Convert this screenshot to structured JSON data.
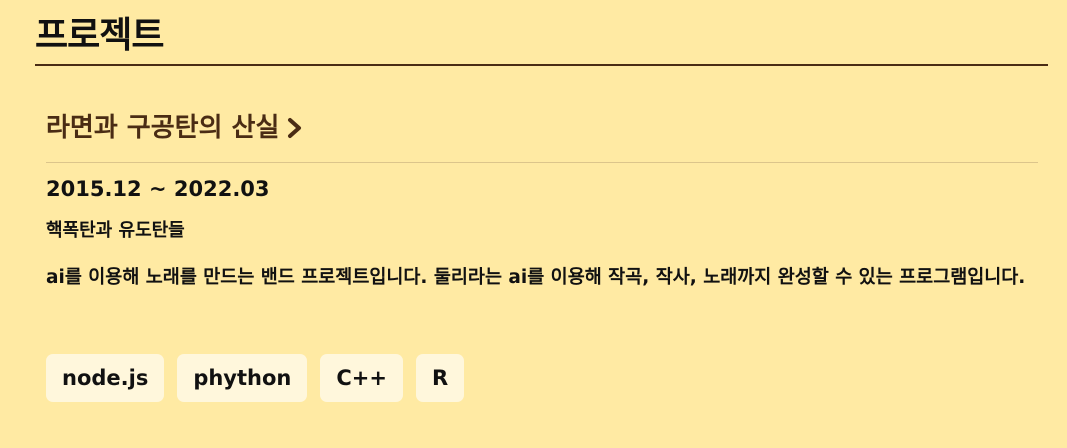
{
  "section": {
    "title": "프로젝트"
  },
  "project": {
    "title": "라면과 구공탄의 산실",
    "chevron_icon": "chevron-right-icon",
    "period": "2015.12 ~ 2022.03",
    "team": "핵폭탄과 유도탄들",
    "description": "ai를 이용해 노래를 만드는 밴드 프로젝트입니다. 둘리라는 ai를 이용해 작곡, 작사, 노래까지 완성할 수 있는 프로그램입니다.",
    "tags": [
      "node.js",
      "phython",
      "C++",
      "R"
    ]
  },
  "colors": {
    "background": "#ffeaa3",
    "title_brown": "#4a2c14",
    "tag_bg": "#fff7dc"
  }
}
